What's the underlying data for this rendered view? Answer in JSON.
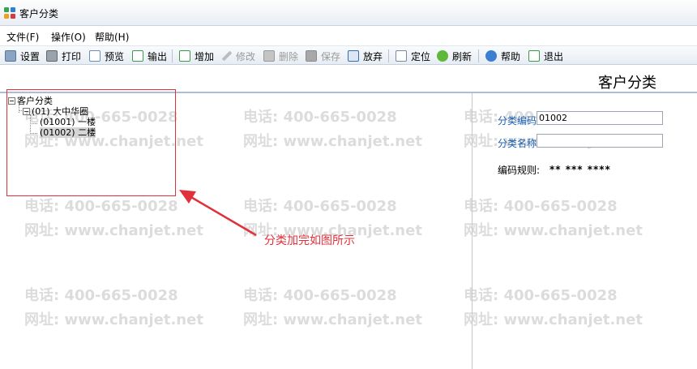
{
  "window": {
    "title": "客户分类"
  },
  "menu": [
    {
      "label": "文件(F)"
    },
    {
      "label": "操作(O)"
    },
    {
      "label": "帮助(H)"
    }
  ],
  "toolbar": [
    {
      "label": "设置",
      "icon": "settings-icon",
      "enabled": true
    },
    {
      "label": "打印",
      "icon": "printer-icon",
      "enabled": true
    },
    {
      "label": "预览",
      "icon": "preview-icon",
      "enabled": true
    },
    {
      "label": "输出",
      "icon": "export-icon",
      "enabled": true
    },
    {
      "label": "增加",
      "icon": "add-icon",
      "enabled": true
    },
    {
      "label": "修改",
      "icon": "pencil-icon",
      "enabled": false
    },
    {
      "label": "删除",
      "icon": "delete-icon",
      "enabled": false
    },
    {
      "label": "保存",
      "icon": "save-icon",
      "enabled": false
    },
    {
      "label": "放弃",
      "icon": "discard-icon",
      "enabled": true
    },
    {
      "label": "定位",
      "icon": "locate-icon",
      "enabled": true
    },
    {
      "label": "刷新",
      "icon": "refresh-icon",
      "enabled": true
    },
    {
      "label": "帮助",
      "icon": "help-icon",
      "enabled": true
    },
    {
      "label": "退出",
      "icon": "exit-icon",
      "enabled": true
    }
  ],
  "page": {
    "title": "客户分类"
  },
  "tree": {
    "root": "客户分类",
    "nodes": [
      {
        "label": "(01) 大中华圈"
      },
      {
        "label": "(01001) 一楼"
      },
      {
        "label": "(01002) 二楼",
        "selected": true
      }
    ]
  },
  "annotation": {
    "text": "分类加完如图所示",
    "color": "#e0303a"
  },
  "form": {
    "code_label": "分类编码",
    "code_value": "01002",
    "name_label": "分类名称",
    "name_value": "",
    "rule_label": "编码规则:",
    "rule_value": "** *** ****"
  },
  "watermark": {
    "phone": "电话: 400-665-0028",
    "site": "网址: www.chanjet.net"
  },
  "colors": {
    "label_blue": "#1a5fb4",
    "annotation_red": "#e0303a"
  }
}
